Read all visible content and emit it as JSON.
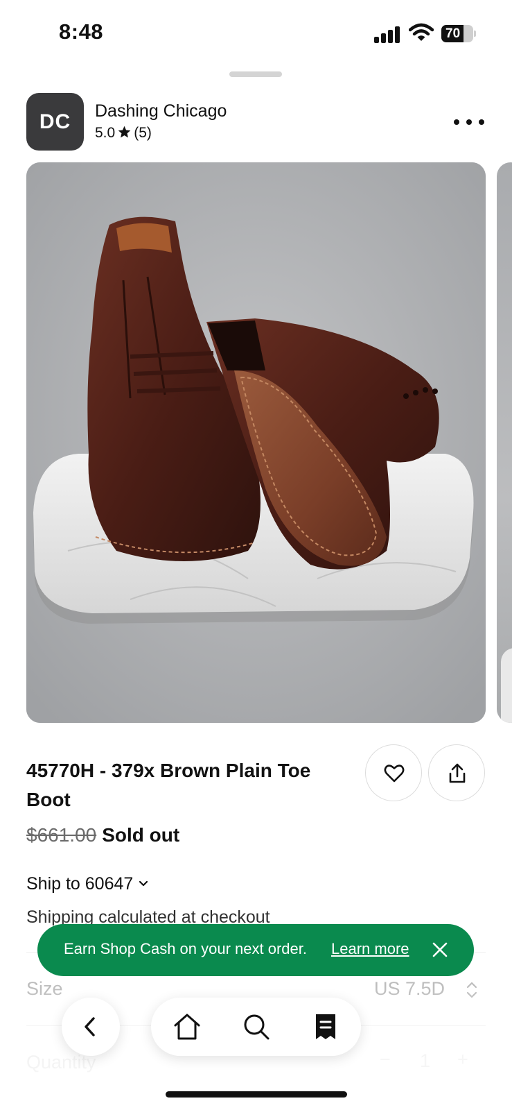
{
  "status_bar": {
    "time": "8:48",
    "battery_level": "70",
    "icons": [
      "signal-icon",
      "wifi-icon",
      "battery-icon"
    ]
  },
  "shop": {
    "avatar_initials": "DC",
    "name": "Dashing Chicago",
    "rating": "5.0",
    "review_count": "(5)"
  },
  "product": {
    "title": "45770H - 379x Brown Plain Toe Boot",
    "original_price": "$661.00",
    "availability": "Sold out",
    "image_subject": "brown leather plain toe boots on marble slab"
  },
  "shipping": {
    "ship_to_label": "Ship to 60647",
    "note": "Shipping calculated at checkout"
  },
  "options": {
    "size_label": "Size",
    "size_value": "US 7.5D",
    "quantity_label": "Quantity",
    "quantity_minus": "−",
    "quantity_value": "1",
    "quantity_plus": "+"
  },
  "toast": {
    "message": "Earn Shop Cash on your next order.",
    "link": "Learn more"
  },
  "nav": {
    "items": [
      "back-icon",
      "home-icon",
      "search-icon",
      "orders-icon"
    ]
  },
  "colors": {
    "toast_bg": "#0a8a4e",
    "avatar_bg": "#3a3a3c",
    "text": "#111111"
  }
}
